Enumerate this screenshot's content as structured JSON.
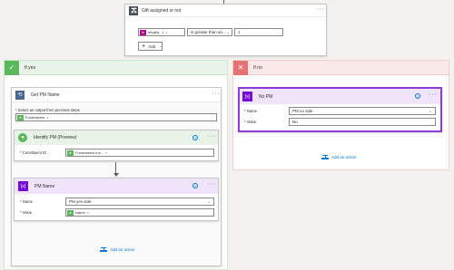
{
  "condition": {
    "title": "Gift assigned or not",
    "token_label": "length(...)",
    "operator": "is greater than an...",
    "value": "1",
    "add_label": "Add"
  },
  "if_yes": {
    "label": "If yes",
    "apply": {
      "title": "Get PM Name",
      "select_label": "* Select an output from previous steps",
      "token_label": "Fundraisers"
    },
    "identify": {
      "title": "Identify PM (Preview)",
      "field_label": "* Constituent ID",
      "token_label": "Fundraisers fun..."
    },
    "pm_name": {
      "title": "PM Name",
      "name_label": "* Name",
      "name_value": "PM yes side",
      "value_label": "* Value",
      "token_label": "Name"
    },
    "add_action": "Add an action"
  },
  "if_no": {
    "label": "If no",
    "no_pm": {
      "title": "No PM",
      "name_label": "* Name",
      "name_value": "PM no side",
      "value_label": "* Value",
      "value_value": "No"
    },
    "add_action": "Add an action"
  },
  "colors": {
    "yes_green": "#5cb85c",
    "no_red": "#e57373",
    "variable_purple": "#770bd6",
    "condition_gray": "#484f58",
    "link_blue": "#0078d4"
  }
}
